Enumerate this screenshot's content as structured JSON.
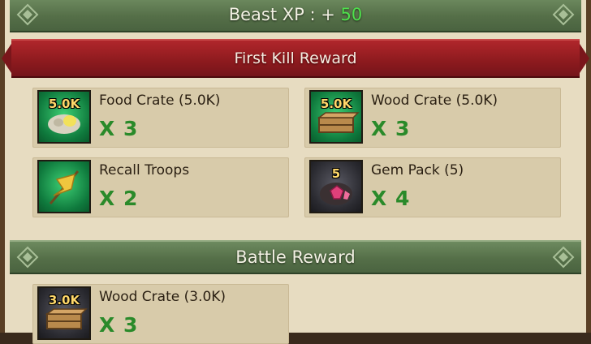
{
  "header": {
    "xp_label": "Beast XP : + ",
    "xp_value": "50"
  },
  "first_kill": {
    "title": "First Kill Reward",
    "items": [
      {
        "name": "Food Crate (5.0K)",
        "count": "X 3",
        "badge": "5.0K",
        "icon": "food-crate-icon"
      },
      {
        "name": "Wood Crate (5.0K)",
        "count": "X 3",
        "badge": "5.0K",
        "icon": "wood-crate-icon"
      },
      {
        "name": "Recall Troops",
        "count": "X 2",
        "badge": "",
        "icon": "recall-flag-icon"
      },
      {
        "name": "Gem Pack (5)",
        "count": "X 4",
        "badge": "5",
        "icon": "gem-pack-icon"
      }
    ]
  },
  "battle": {
    "title": "Battle Reward",
    "items": [
      {
        "name": "Wood Crate (3.0K)",
        "count": "X 3",
        "badge": "3.0K",
        "icon": "wood-crate-icon"
      }
    ]
  },
  "colors": {
    "header_green": "#556f48",
    "ribbon_red": "#8c1a1e",
    "count_green": "#2a8a2a",
    "xp_green": "#4fe04c"
  }
}
